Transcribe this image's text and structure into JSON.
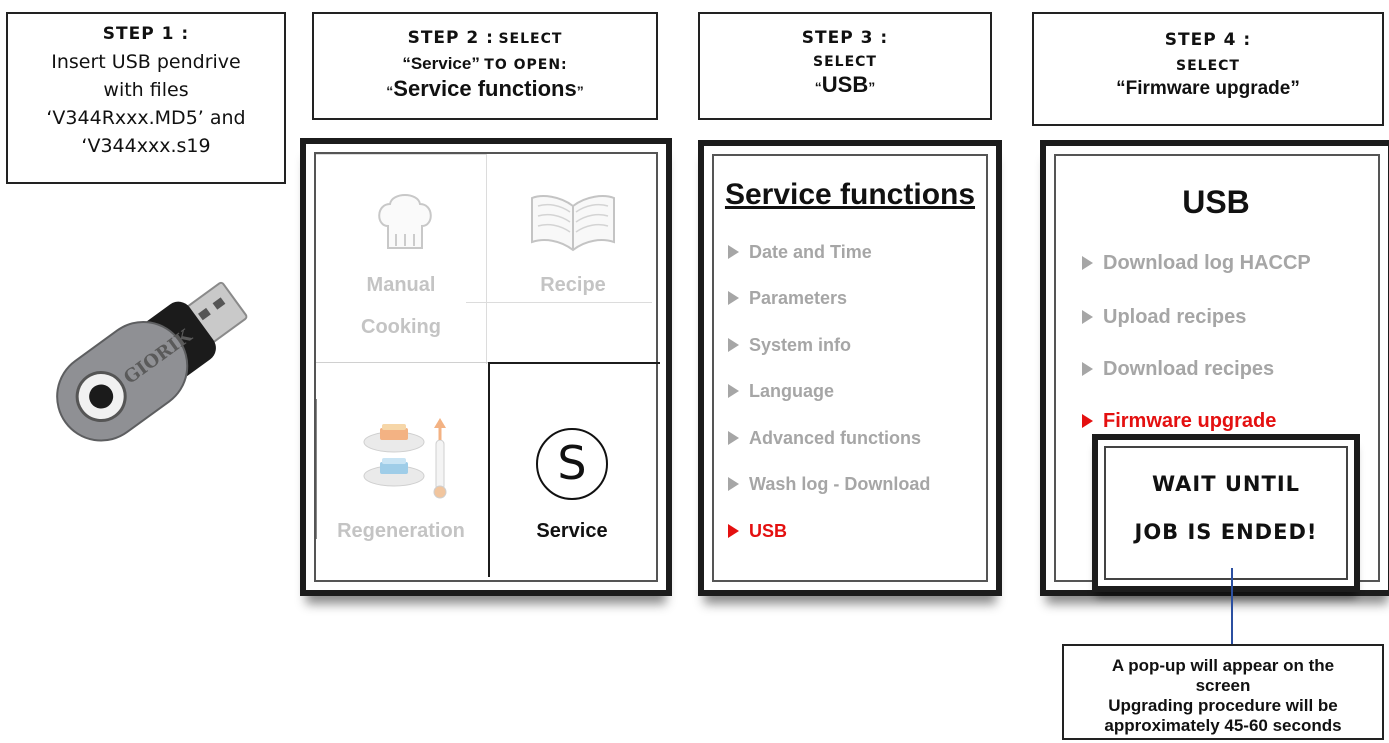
{
  "step1": {
    "title": "STEP 1 :",
    "lines": [
      "Insert USB pendrive",
      "with files",
      "‘V344Rxxx.MD5’ and",
      "‘V344xxx.s19"
    ]
  },
  "step2": {
    "title": "STEP 2 :",
    "select": "SELECT",
    "quoted": "“Service”",
    "to_open": "TO OPEN:",
    "q_open": "“",
    "target": "Service functions",
    "q_close": "”"
  },
  "step3": {
    "title": "STEP 3 :",
    "select": "SELECT",
    "q_open": "“",
    "target": "USB",
    "q_close": "”"
  },
  "step4": {
    "title": "STEP 4 :",
    "select": "SELECT",
    "target": "“Firmware upgrade”"
  },
  "usb_drive": {
    "brand": "GIORIK"
  },
  "screen_main": {
    "tiles": [
      {
        "label1": "Manual",
        "label2": "Cooking",
        "icon": "chef-hat-icon",
        "active": false
      },
      {
        "label1": "Recipe",
        "label2": "",
        "icon": "book-icon",
        "active": false
      },
      {
        "label1": "Regeneration",
        "label2": "",
        "icon": "regeneration-icon",
        "active": false
      },
      {
        "label1": "Service",
        "label2": "",
        "icon": "service-icon",
        "active": true
      }
    ],
    "service_glyph": "S"
  },
  "screen_service": {
    "title": "Service functions",
    "items": [
      {
        "label": "Date and Time",
        "selected": false
      },
      {
        "label": "Parameters",
        "selected": false
      },
      {
        "label": "System info",
        "selected": false
      },
      {
        "label": "Language",
        "selected": false
      },
      {
        "label": "Advanced functions",
        "selected": false
      },
      {
        "label": "Wash log - Download",
        "selected": false
      },
      {
        "label": "USB",
        "selected": true
      }
    ]
  },
  "screen_usb": {
    "title": "USB",
    "items": [
      {
        "label": "Download log HACCP",
        "selected": false
      },
      {
        "label": "Upload recipes",
        "selected": false
      },
      {
        "label": "Download recipes",
        "selected": false
      },
      {
        "label": "Firmware upgrade",
        "selected": true
      }
    ],
    "popup_line1": "WAIT UNTIL",
    "popup_line2": "JOB IS ENDED!"
  },
  "note": {
    "line1": "A pop-up will appear on the",
    "line2": "screen",
    "line3": "Upgrading procedure will be",
    "line4": "approximately 45-60 seconds"
  },
  "colors": {
    "selected": "#e41010",
    "inactive": "#a6a6a6",
    "frame": "#1c1c1c",
    "connector": "#2b4fa0"
  }
}
